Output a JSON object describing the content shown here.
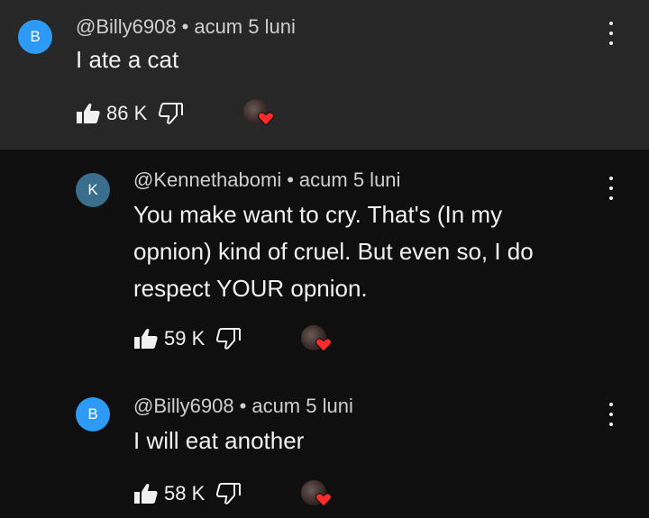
{
  "comments": [
    {
      "avatar_letter": "B",
      "handle": "@Billy6908",
      "time": "acum 5 luni",
      "text": "I ate a cat",
      "likes": "86 K"
    },
    {
      "avatar_letter": "K",
      "handle": "@Kennethabomi",
      "time": "acum 5 luni",
      "text_lines": [
        "You make want to cry. That's (In my",
        "opnion) kind of cruel. But even so, I do",
        "respect YOUR opnion."
      ],
      "likes": "59 K"
    },
    {
      "avatar_letter": "B",
      "handle": "@Billy6908",
      "time": "acum 5 luni",
      "text": "I will eat another",
      "likes": "58 K"
    }
  ],
  "separator": "•",
  "icons": {
    "like": "thumbs-up-icon",
    "dislike": "thumbs-down-icon",
    "menu": "more-vertical-icon",
    "creator_heart": "creator-heart-icon"
  },
  "colors": {
    "background": "#0f0f0f",
    "highlight_background": "#272727",
    "avatar_b": "#2d9af5",
    "avatar_k": "#3b6d8c",
    "heart": "#ff2a2a"
  }
}
